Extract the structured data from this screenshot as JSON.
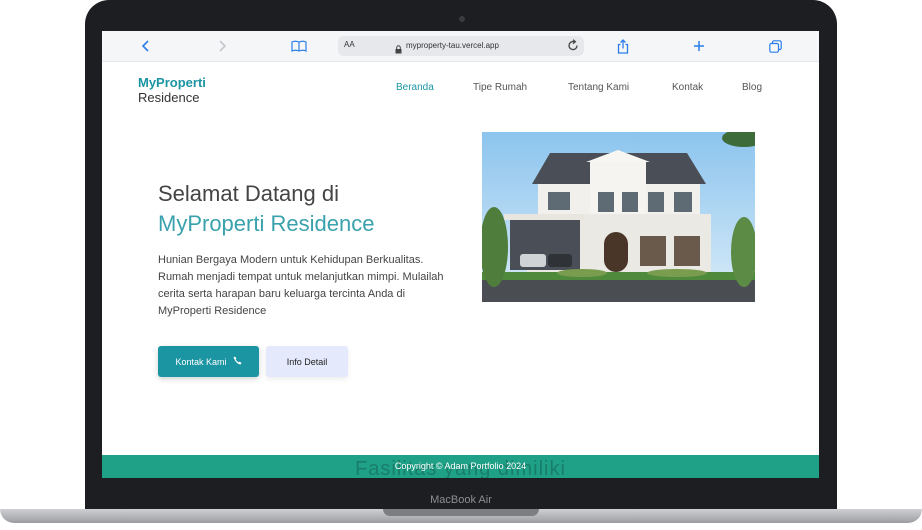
{
  "device": {
    "label": "MacBook Air"
  },
  "browser": {
    "text_size_label": "AA",
    "url": "myproperty-tau.vercel.app",
    "icons": [
      "back-icon",
      "forward-icon",
      "book-icon",
      "lock-icon",
      "reload-icon",
      "share-icon",
      "plus-icon",
      "tabs-icon"
    ]
  },
  "site": {
    "brand_top": "MyProperti",
    "brand_bottom": "Residence",
    "nav": [
      "Beranda",
      "Tipe Rumah",
      "Tentang Kami",
      "Kontak",
      "Blog"
    ],
    "hero": {
      "title_line1": "Selamat Datang di",
      "title_line2": "MyProperti Residence",
      "description": "Hunian Bergaya Modern untuk Kehidupan Berkualitas. Rumah menjadi tempat untuk melanjutkan mimpi. Mulailah cerita serta harapan baru keluarga tercinta Anda di MyProperti Residence",
      "primary_button": "Kontak Kami",
      "secondary_button": "Info Detail"
    },
    "footer": {
      "copyright": "Copyright © Adam Portfolio 2024",
      "ghost_heading": "Fasilitas yang dimiliki"
    }
  },
  "colors": {
    "accent": "#1c95a3",
    "footer": "#1fa187",
    "secondary_button": "#e4eafb"
  }
}
